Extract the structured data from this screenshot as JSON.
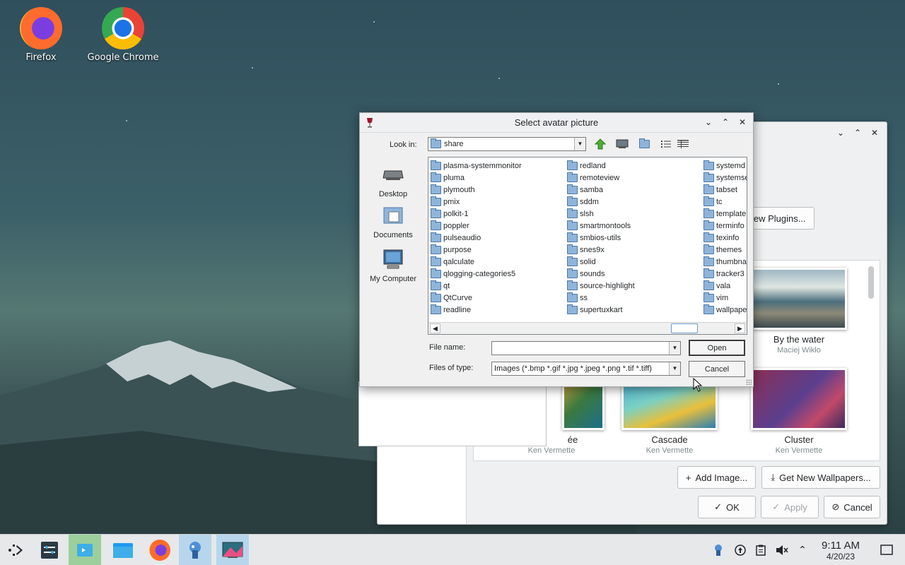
{
  "desktop": {
    "icons": [
      {
        "label": "Firefox"
      },
      {
        "label": "Google Chrome"
      }
    ]
  },
  "background_window": {
    "get_plugins_label": "New Plugins...",
    "wallpapers": [
      {
        "title": "By the water",
        "author": "Maciej Wiklo"
      },
      {
        "title": "ée",
        "author": "Ken Vermette"
      },
      {
        "title": "Cascade",
        "author": "Ken Vermette"
      },
      {
        "title": "Cluster",
        "author": "Ken Vermette"
      }
    ],
    "add_image_label": "Add Image...",
    "get_wallpapers_label": "Get New Wallpapers...",
    "ok_label": "OK",
    "apply_label": "Apply",
    "cancel_label": "Cancel"
  },
  "dialog": {
    "title": "Select avatar picture",
    "look_in_label": "Look in:",
    "look_in_value": "share",
    "places": [
      {
        "label": "Desktop"
      },
      {
        "label": "Documents"
      },
      {
        "label": "My Computer"
      }
    ],
    "folders_col1": [
      "plasma-systemmonitor",
      "pluma",
      "plymouth",
      "pmix",
      "polkit-1",
      "poppler",
      "pulseaudio",
      "purpose",
      "qalculate",
      "qlogging-categories5",
      "qt",
      "QtCurve",
      "readline"
    ],
    "folders_col2": [
      "redland",
      "remoteview",
      "samba",
      "sddm",
      "slsh",
      "smartmontools",
      "smbios-utils",
      "snes9x",
      "solid",
      "sounds",
      "source-highlight",
      "ss",
      "supertuxkart"
    ],
    "folders_col3": [
      "systemd",
      "systemse",
      "tabset",
      "tc",
      "template",
      "terminfo",
      "texinfo",
      "themes",
      "thumbna",
      "tracker3",
      "vala",
      "vim",
      "wallpape"
    ],
    "file_name_label": "File name:",
    "file_name_value": "",
    "files_of_type_label": "Files of type:",
    "files_of_type_value": "Images (*.bmp *.gif *.jpg *.jpeg *.png *.tif *.tiff)",
    "open_label": "Open",
    "cancel_label": "Cancel"
  },
  "taskbar": {
    "time": "9:11 AM",
    "date": "4/20/23"
  }
}
